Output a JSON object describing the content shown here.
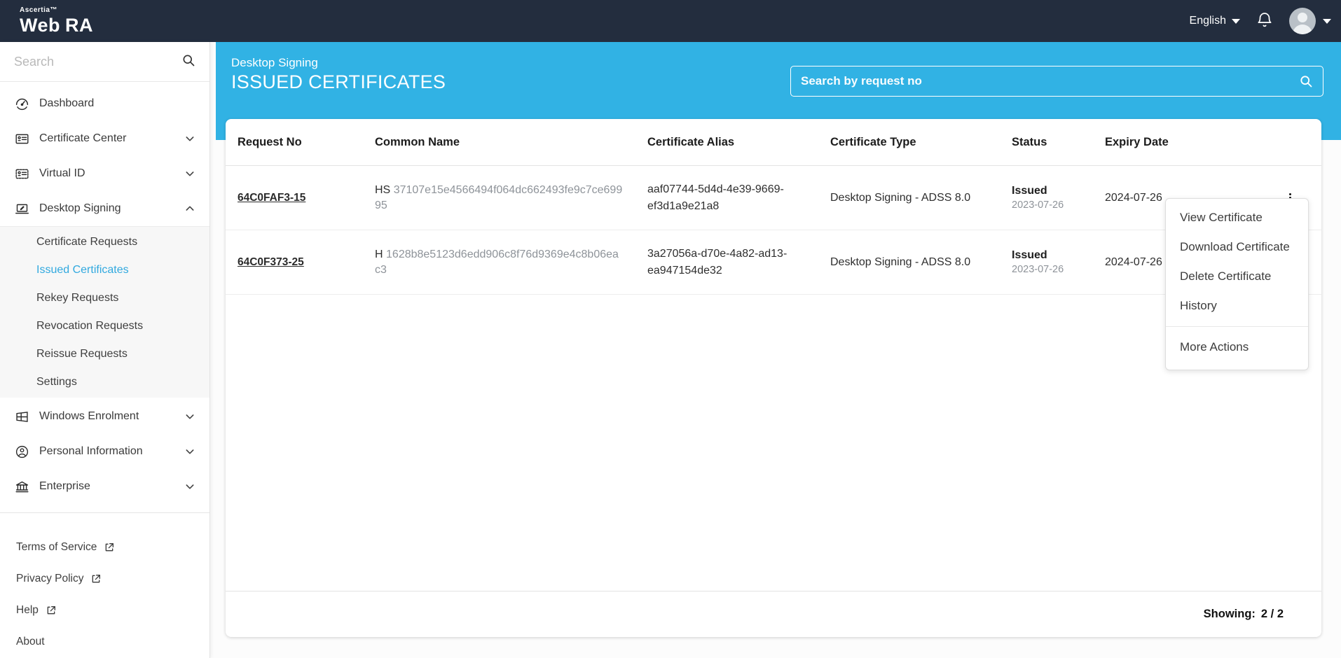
{
  "colors": {
    "accent": "#31b2e4",
    "navbar_bg": "#232d3e",
    "active_link": "#31a9df"
  },
  "navbar": {
    "brand_top": "Ascertia™",
    "brand_part1": "Web",
    "brand_part2": "RA",
    "language": "English",
    "icons": [
      "caret-down-icon",
      "bell-icon",
      "avatar",
      "caret-down-icon"
    ]
  },
  "sidebar": {
    "search_placeholder": "Search",
    "items": [
      {
        "label": "Dashboard",
        "icon": "dashboard-icon",
        "chevron": null
      },
      {
        "label": "Certificate Center",
        "icon": "certificate-card-icon",
        "chevron": "down"
      },
      {
        "label": "Virtual ID",
        "icon": "virtual-id-card-icon",
        "chevron": "down"
      },
      {
        "label": "Desktop Signing",
        "icon": "desktop-signing-icon",
        "chevron": "up",
        "expanded": true
      }
    ],
    "submenu": {
      "active": "Issued Certificates",
      "items": [
        "Certificate Requests",
        "Issued Certificates",
        "Rekey Requests",
        "Revocation Requests",
        "Reissue Requests",
        "Settings"
      ]
    },
    "items_lower": [
      {
        "label": "Windows Enrolment",
        "icon": "windows-icon",
        "chevron": "down"
      },
      {
        "label": "Personal Information",
        "icon": "person-circle-icon",
        "chevron": "down"
      },
      {
        "label": "Enterprise",
        "icon": "bank-icon",
        "chevron": "down"
      }
    ],
    "footer_links": [
      {
        "label": "Terms of Service",
        "external": true
      },
      {
        "label": "Privacy Policy",
        "external": true
      },
      {
        "label": "Help",
        "external": true
      },
      {
        "label": "About",
        "external": false
      }
    ]
  },
  "header": {
    "breadcrumb": "Desktop Signing",
    "title": "ISSUED CERTIFICATES",
    "search_placeholder": "Search by request no"
  },
  "table": {
    "columns": [
      "Request No",
      "Common Name",
      "Certificate Alias",
      "Certificate Type",
      "Status",
      "Expiry Date"
    ],
    "rows": [
      {
        "request_no": "64C0FAF3-15",
        "common_name_prefix": "HS",
        "common_name_hash": "37107e15e4566494f064dc662493fe9c7ce69995",
        "alias": "aaf07744-5d4d-4e39-9669-ef3d1a9e21a8",
        "type": "Desktop Signing - ADSS 8.0",
        "status": "Issued",
        "status_date": "2023-07-26",
        "expiry": "2024-07-26"
      },
      {
        "request_no": "64C0F373-25",
        "common_name_prefix": "H",
        "common_name_hash": "1628b8e5123d6edd906c8f76d9369e4c8b06eac3",
        "alias": "3a27056a-d70e-4a82-ad13-ea947154de32",
        "type": "Desktop Signing - ADSS 8.0",
        "status": "Issued",
        "status_date": "2023-07-26",
        "expiry": "2024-07-26"
      }
    ],
    "showing_label": "Showing:",
    "showing_value": "2 / 2"
  },
  "context_menu": {
    "items": [
      "View Certificate",
      "Download Certificate",
      "Delete Certificate",
      "History"
    ],
    "more_label": "More Actions"
  }
}
